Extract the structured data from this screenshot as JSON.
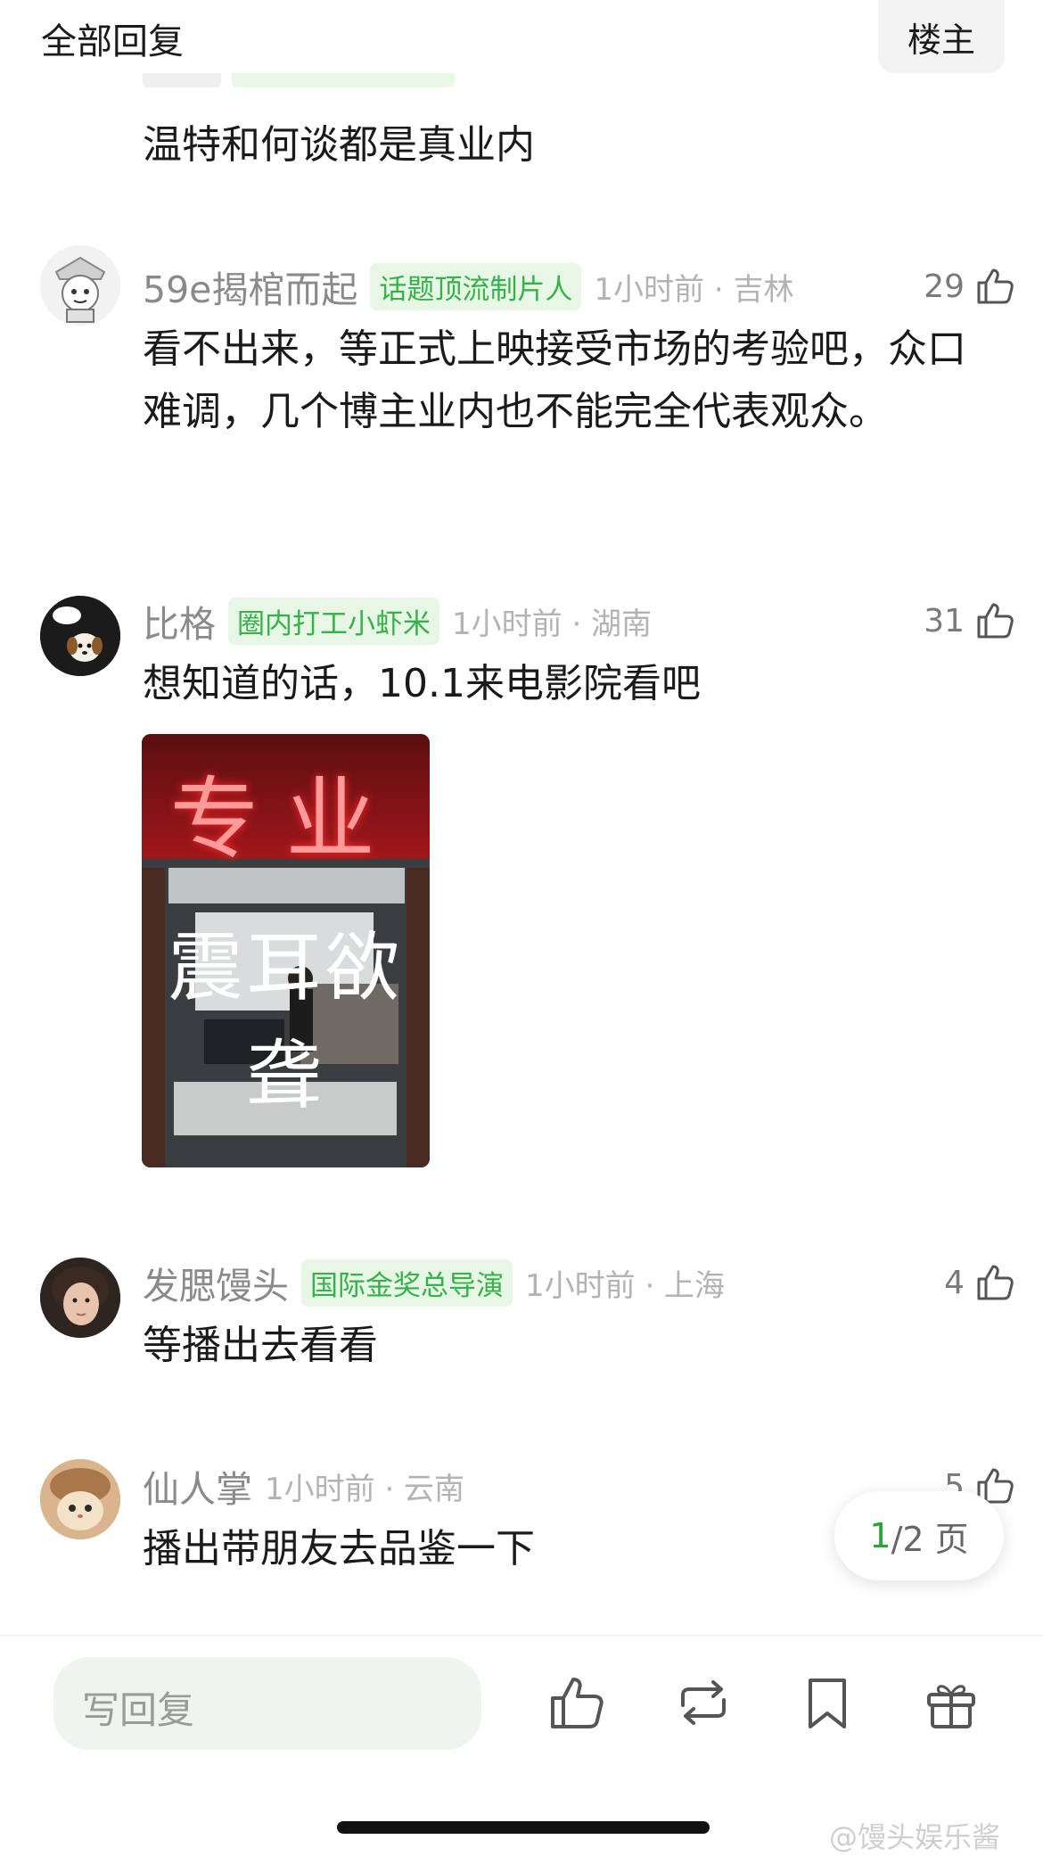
{
  "header": {
    "title": "全部回复",
    "owner_button": "楼主"
  },
  "prev_comment": {
    "text": "温特和何谈都是真业内"
  },
  "comments": [
    {
      "username": "59e揭棺而起",
      "tag": "话题顶流制片人",
      "time": "1小时前 · 吉林",
      "likes": "29",
      "text": "看不出来，等正式上映接受市场的考验吧，众口难调，几个博主业内也不能完全代表观众。"
    },
    {
      "username": "比格",
      "tag": "圈内打工小虾米",
      "time": "1小时前 · 湖南",
      "likes": "31",
      "text": "想知道的话，10.1来电影院看吧"
    },
    {
      "username": "发腮馒头",
      "tag": "国际金奖总导演",
      "time": "1小时前 · 上海",
      "likes": "4",
      "text": "等播出去看看"
    },
    {
      "username": "仙人掌",
      "tag": "",
      "time": "1小时前 · 云南",
      "likes": "5",
      "text": "播出带朋友去品鉴一下"
    }
  ],
  "poster": {
    "sign_text": "专业",
    "title": "震耳欲聋"
  },
  "pagination": {
    "current": "1",
    "total_suffix": "/2 页"
  },
  "bottom_bar": {
    "reply_placeholder": "写回复"
  },
  "watermark": "@馒头娱乐酱",
  "colors": {
    "tag_green": "#36b24a",
    "tag_bg": "#e7f6e5",
    "page_accent": "#27a33a"
  }
}
